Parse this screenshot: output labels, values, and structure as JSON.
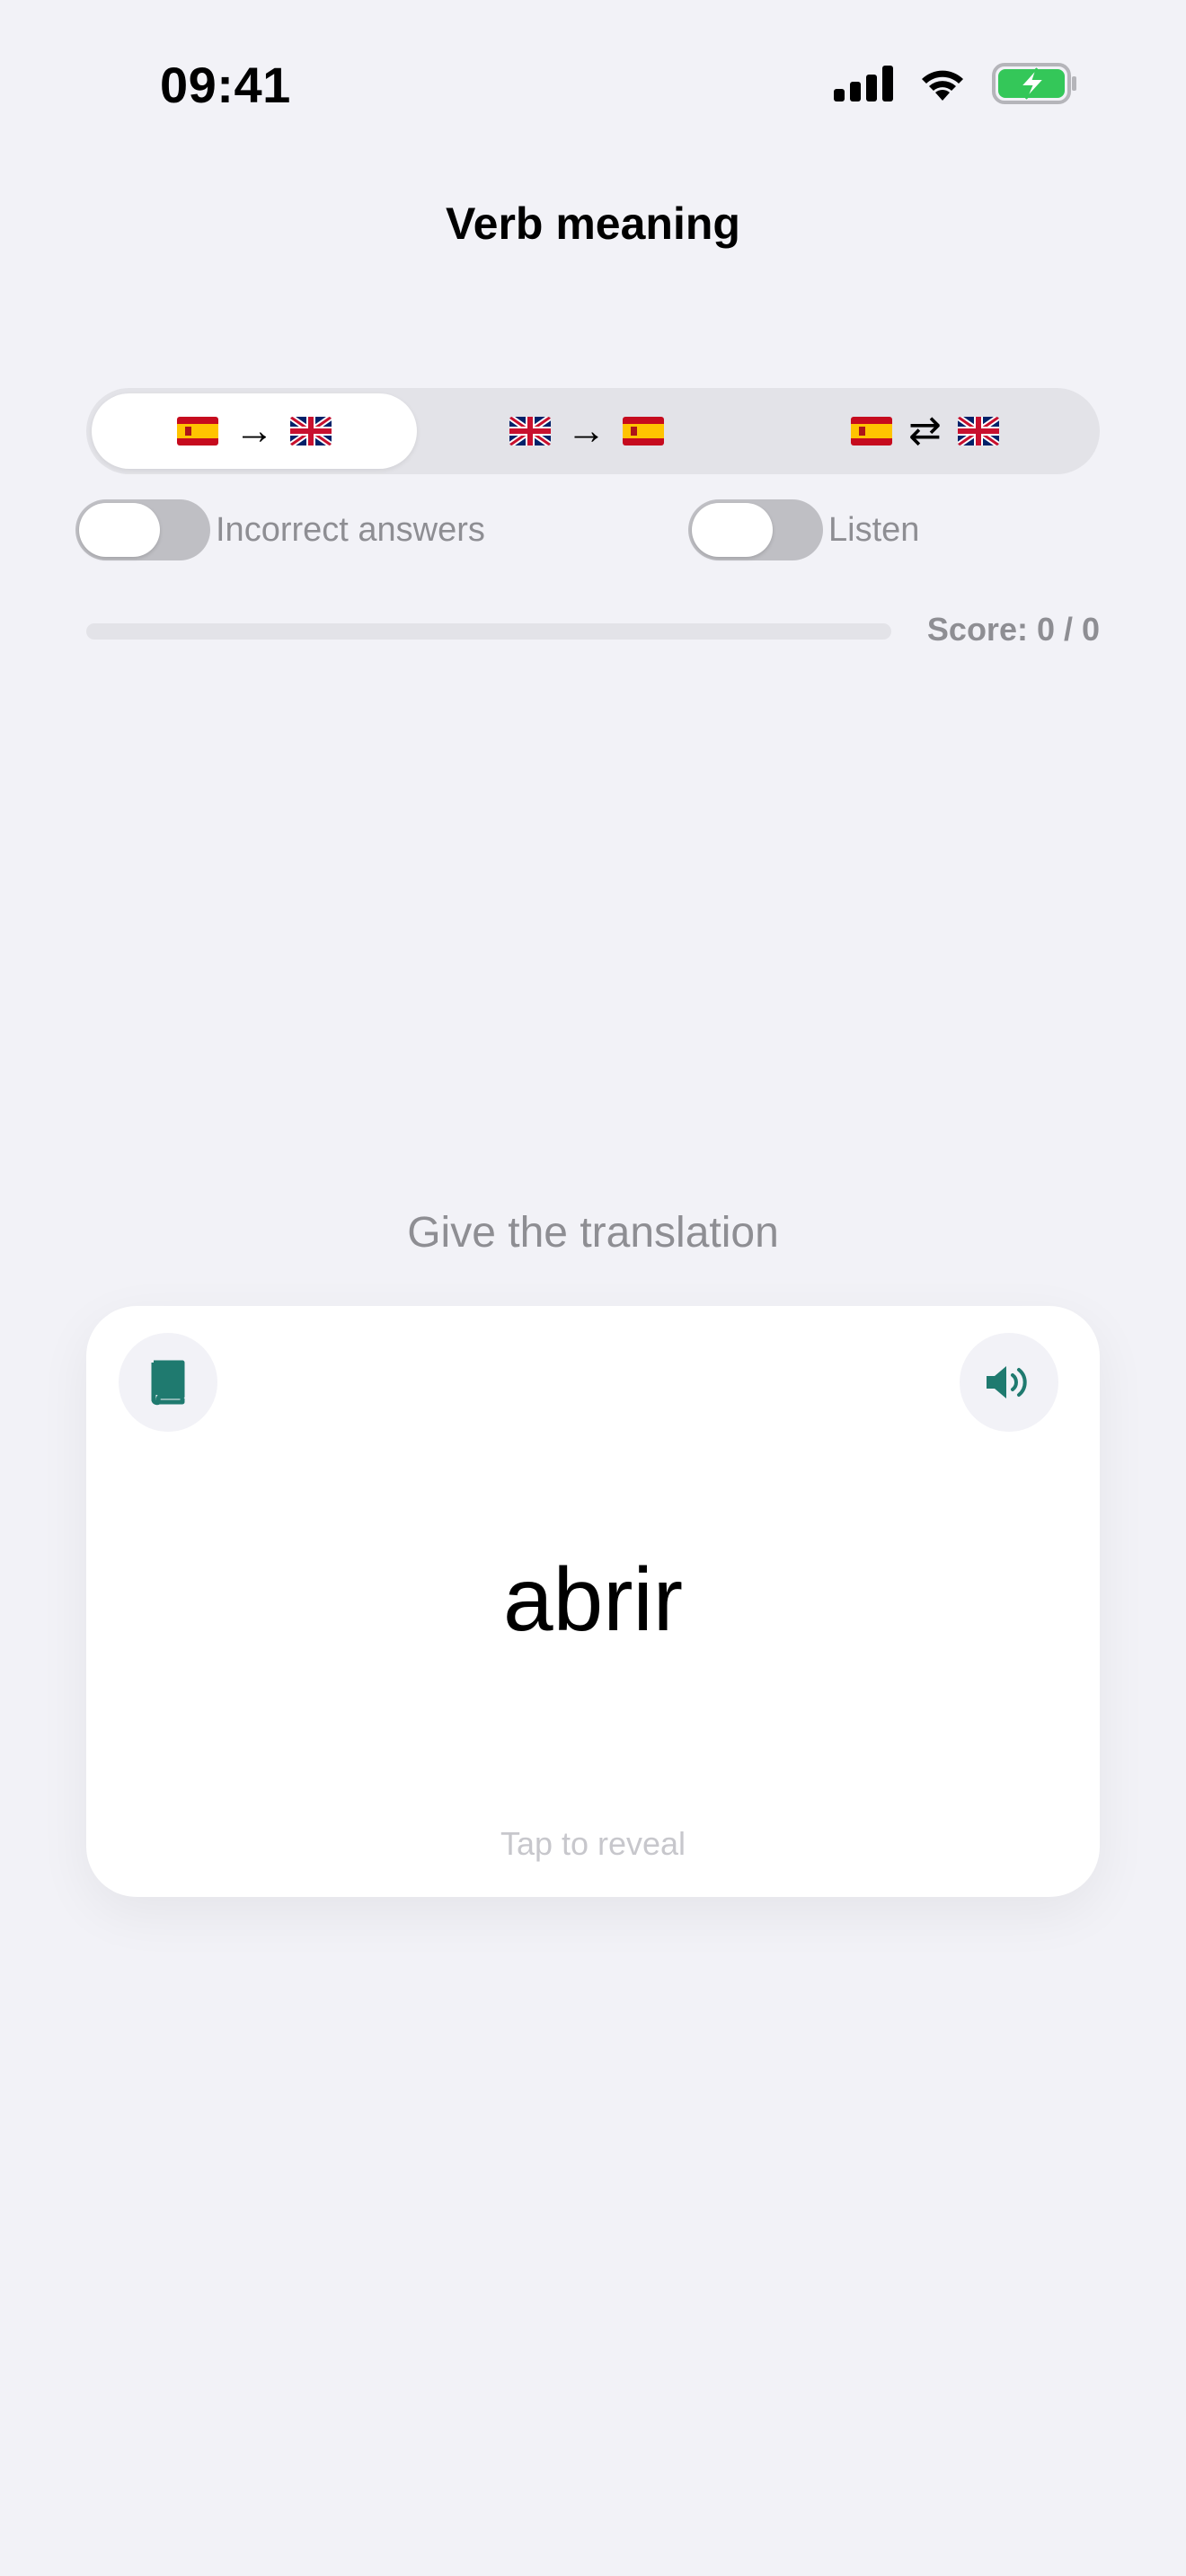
{
  "status_bar": {
    "time": "09:41"
  },
  "header": {
    "title": "Verb meaning"
  },
  "direction_selector": {
    "options": [
      {
        "from": "es-flag",
        "arrow": "→",
        "to": "uk-flag",
        "selected": true
      },
      {
        "from": "uk-flag",
        "arrow": "→",
        "to": "es-flag",
        "selected": false
      },
      {
        "from": "es-flag",
        "arrow": "⇄",
        "to": "uk-flag",
        "selected": false
      }
    ]
  },
  "toggles": {
    "incorrect": {
      "label": "Incorrect answers",
      "on": false
    },
    "listen": {
      "label": "Listen",
      "on": false
    }
  },
  "progress": {
    "fraction": 0,
    "score_text": "Score: 0 / 0"
  },
  "prompt": "Give the translation",
  "card": {
    "word": "abrir",
    "reveal_hint": "Tap to reveal",
    "left_icon": "book-icon",
    "right_icon": "speaker-icon"
  },
  "colors": {
    "accent": "#1f7a6f",
    "background": "#f2f2f7",
    "battery": "#34c759"
  }
}
